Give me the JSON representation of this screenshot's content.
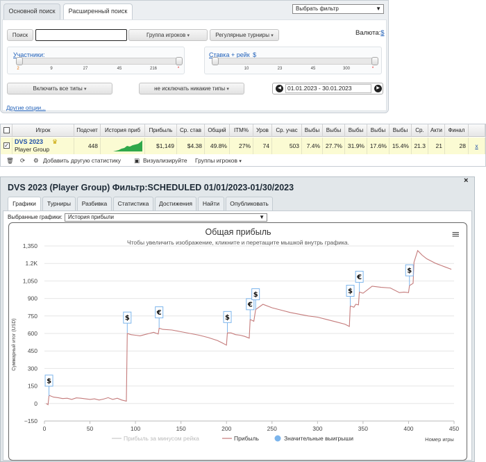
{
  "search": {
    "tabs": [
      "Основной поиск",
      "Расширенный поиск"
    ],
    "filter_select": "Выбрать фильтр",
    "search_button": "Поиск",
    "search_input": "",
    "player_group_button": "Группа игроков",
    "regular_tournaments_button": "Регулярные турниры",
    "currency_label": "Валюта:",
    "currency_value": "$",
    "participants_label": "Участники:",
    "participants_ticks": [
      "2",
      "9",
      "27",
      "45",
      "216",
      "*"
    ],
    "stake_label": "Ставка + рейк",
    "stake_currency": "$",
    "stake_ticks": [
      "10",
      "23",
      "45",
      "300",
      "*"
    ],
    "include_types_button": "Включить все типы",
    "exclude_types_button": "не исключать никакие типы",
    "date_range": "01.01.2023 - 30.01.2023",
    "date_prev": "◀",
    "date_next": "▶",
    "other_options_link": "Другие опции..."
  },
  "stats": {
    "headers": [
      "Игрок",
      "Подсчет",
      "История приб",
      "Прибыль",
      "Ср. став",
      "Общий",
      "ITM%",
      "Уров",
      "Ср. учас",
      "Выбы",
      "Выбы",
      "Выбы",
      "Выбы",
      "Выбы",
      "Ср. ",
      "Акти",
      "Финал"
    ],
    "row": {
      "player_name": "DVS 2023",
      "player_group": "Player Group",
      "count": "448",
      "profit": "$1,149",
      "avg_stake": "$4.38",
      "total": "49.8%",
      "itm": "27%",
      "level": "74",
      "avg_participants": "503",
      "out1": "7.4%",
      "out2": "27.7%",
      "out3": "31.9%",
      "out4": "17.6%",
      "out5": "15.4%",
      "avg": "21.3",
      "active": "21",
      "final": "28",
      "remove": "x",
      "checked": "✓"
    },
    "toolbar": {
      "add_stat": "Добавить другую статистику",
      "visualize": "Визуализируйте",
      "player_groups": "Группы игроков"
    }
  },
  "report": {
    "title": "DVS 2023 (Player Group) Фильтр:SCHEDULED 01/01/2023-01/30/2023",
    "tabs": [
      "Графики",
      "Турниры",
      "Разбивка",
      "Статистика",
      "Достижения",
      "Найти",
      "Опубликовать"
    ],
    "selected_charts_label": "Выбранные графики:",
    "selected_chart": "История прибыли",
    "close": "×",
    "menu_icon": "≡"
  },
  "chart_data": {
    "type": "line",
    "title": "Общая прибыль",
    "subtitle": "Чтобы увеличить изображение, кликните и перетащите мышкой внутрь графика.",
    "xlabel": "Номер игры",
    "ylabel": "Суммарный итог (USD)",
    "xlim": [
      0,
      450
    ],
    "ylim": [
      -150,
      1350
    ],
    "x_ticks": [
      "0",
      "50",
      "100",
      "150",
      "200",
      "250",
      "300",
      "350",
      "400",
      "450"
    ],
    "y_ticks": [
      "−150",
      "0",
      "150",
      "300",
      "450",
      "600",
      "750",
      "900",
      "1,050",
      "1.2K",
      "1,350"
    ],
    "legend": [
      "Прибыль за минусом рейка",
      "Прибыль",
      "Значительные выигрыши"
    ],
    "series": [
      {
        "name": "Прибыль",
        "color": "#c47a7a",
        "points": [
          [
            2,
            0
          ],
          [
            4,
            -10
          ],
          [
            5,
            70
          ],
          [
            10,
            55
          ],
          [
            15,
            50
          ],
          [
            20,
            42
          ],
          [
            25,
            45
          ],
          [
            30,
            35
          ],
          [
            35,
            48
          ],
          [
            40,
            45
          ],
          [
            45,
            40
          ],
          [
            50,
            35
          ],
          [
            55,
            40
          ],
          [
            60,
            30
          ],
          [
            65,
            38
          ],
          [
            70,
            50
          ],
          [
            75,
            35
          ],
          [
            80,
            45
          ],
          [
            85,
            30
          ],
          [
            90,
            20
          ],
          [
            91,
            600
          ],
          [
            95,
            590
          ],
          [
            100,
            585
          ],
          [
            105,
            580
          ],
          [
            110,
            590
          ],
          [
            115,
            600
          ],
          [
            120,
            610
          ],
          [
            125,
            595
          ],
          [
            126,
            645
          ],
          [
            130,
            635
          ],
          [
            140,
            630
          ],
          [
            150,
            615
          ],
          [
            160,
            600
          ],
          [
            170,
            585
          ],
          [
            180,
            565
          ],
          [
            190,
            540
          ],
          [
            195,
            520
          ],
          [
            200,
            500
          ],
          [
            201,
            605
          ],
          [
            205,
            605
          ],
          [
            210,
            590
          ],
          [
            215,
            585
          ],
          [
            220,
            575
          ],
          [
            225,
            560
          ],
          [
            226,
            720
          ],
          [
            230,
            705
          ],
          [
            232,
            805
          ],
          [
            240,
            850
          ],
          [
            250,
            820
          ],
          [
            260,
            800
          ],
          [
            270,
            780
          ],
          [
            280,
            765
          ],
          [
            290,
            750
          ],
          [
            300,
            740
          ],
          [
            310,
            720
          ],
          [
            320,
            700
          ],
          [
            330,
            680
          ],
          [
            335,
            660
          ],
          [
            336,
            835
          ],
          [
            340,
            825
          ],
          [
            342,
            850
          ],
          [
            345,
            845
          ],
          [
            346,
            955
          ],
          [
            350,
            945
          ],
          [
            360,
            1005
          ],
          [
            370,
            995
          ],
          [
            380,
            990
          ],
          [
            390,
            950
          ],
          [
            395,
            955
          ],
          [
            400,
            950
          ],
          [
            401,
            1010
          ],
          [
            405,
            1030
          ],
          [
            406,
            1210
          ],
          [
            410,
            1310
          ],
          [
            415,
            1270
          ],
          [
            420,
            1240
          ],
          [
            430,
            1200
          ],
          [
            440,
            1170
          ],
          [
            447,
            1150
          ]
        ]
      }
    ],
    "significant_wins": [
      {
        "x": 5,
        "y": 65,
        "currency": "$"
      },
      {
        "x": 91,
        "y": 605,
        "currency": "$"
      },
      {
        "x": 126,
        "y": 650,
        "currency": "€"
      },
      {
        "x": 201,
        "y": 610,
        "currency": "$"
      },
      {
        "x": 226,
        "y": 720,
        "currency": "€"
      },
      {
        "x": 232,
        "y": 805,
        "currency": "$"
      },
      {
        "x": 336,
        "y": 835,
        "currency": "$"
      },
      {
        "x": 346,
        "y": 955,
        "currency": "€"
      },
      {
        "x": 401,
        "y": 1010,
        "currency": "$"
      }
    ]
  }
}
